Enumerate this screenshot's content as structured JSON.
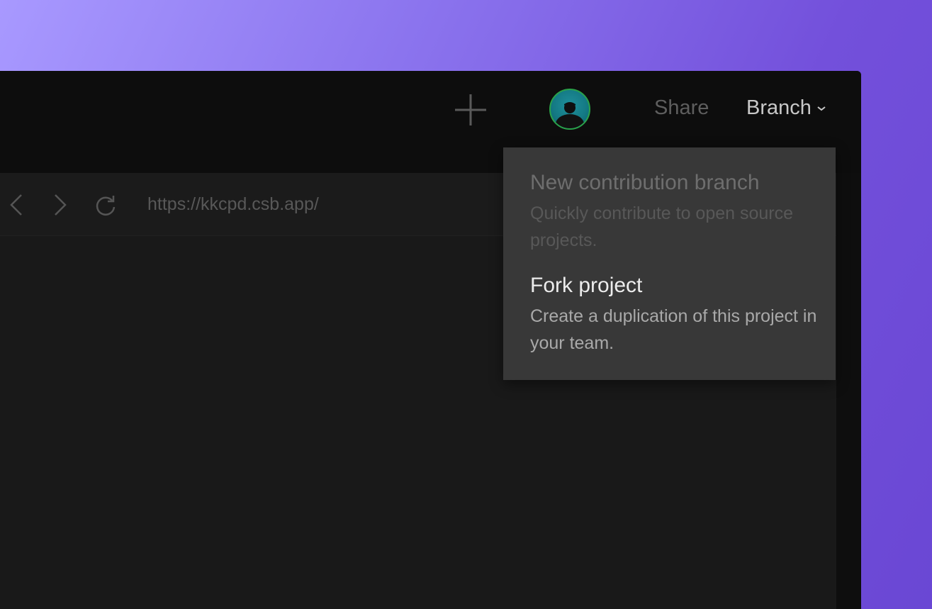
{
  "toolbar": {
    "add_icon": "plus-icon",
    "avatar_icon": "user-avatar",
    "share_label": "Share",
    "branch_label": "Branch",
    "branch_chevron_icon": "chevron-down-icon"
  },
  "browser": {
    "back_icon": "chevron-left-icon",
    "forward_icon": "chevron-right-icon",
    "reload_icon": "reload-icon",
    "url": "https://kkcpd.csb.app/"
  },
  "branch_menu": {
    "items": [
      {
        "title": "New contribution branch",
        "description": "Quickly contribute to open source projects.",
        "enabled": false
      },
      {
        "title": "Fork project",
        "description": "Create a duplication of this project in your team.",
        "enabled": true
      }
    ]
  },
  "colors": {
    "background_gradient_start": "#a899ff",
    "background_gradient_end": "#6a47d4",
    "window_bg": "#0d0d0d",
    "preview_bg": "#191919",
    "menu_bg": "#383838",
    "avatar_ring": "#2aa34a"
  }
}
